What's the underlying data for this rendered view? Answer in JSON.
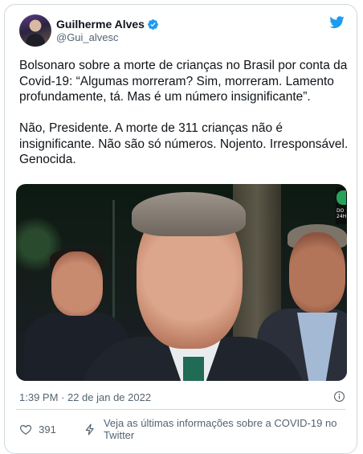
{
  "author": {
    "name": "Guilherme Alves",
    "handle": "@Gui_alvesc",
    "verified": true
  },
  "tweet": {
    "text": "Bolsonaro sobre a morte de crianças no Brasil por conta da Covid-19: “Algumas morreram? Sim, morreram. Lamento profundamente, tá. Mas é um número insignificante”.\n\nNão, Presidente. A morte de 311 crianças não é insignificante. Não são só números. Nojento. Irresponsável. Genocida.",
    "timestamp": "1:39 PM · 22 de jan de 2022"
  },
  "media": {
    "channel_logo_text": "DO\n24H"
  },
  "actions": {
    "like_count": "391",
    "covid_info": "Veja as últimas informações sobre a COVID-19 no Twitter"
  },
  "colors": {
    "brand": "#1d9bf0",
    "secondary_text": "#536471",
    "border": "#cfd9de"
  },
  "icons": [
    "verified-badge-icon",
    "twitter-bird-icon",
    "info-icon",
    "heart-icon",
    "bolt-icon"
  ]
}
